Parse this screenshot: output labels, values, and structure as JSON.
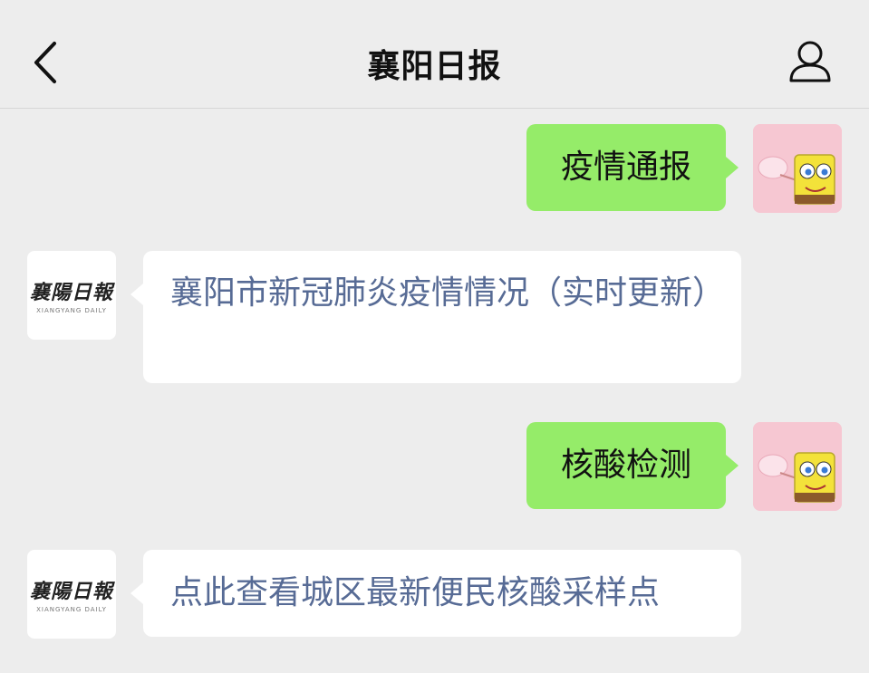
{
  "header": {
    "title": "襄阳日报"
  },
  "icons": {
    "back": "chevron-left-icon",
    "profile": "person-icon"
  },
  "account": {
    "logo_cn": "襄陽日報",
    "logo_en": "XIANGYANG DAILY"
  },
  "messages": [
    {
      "sender": "user",
      "text": "疫情通报"
    },
    {
      "sender": "account",
      "text": "襄阳市新冠肺炎疫情情况（实时更新）"
    },
    {
      "sender": "user",
      "text": "核酸检测"
    },
    {
      "sender": "account",
      "text": "点此查看城区最新便民核酸采样点"
    }
  ],
  "colors": {
    "background": "#ededed",
    "user_bubble": "#95ec69",
    "account_bubble": "#ffffff",
    "link_text": "#576b95"
  }
}
